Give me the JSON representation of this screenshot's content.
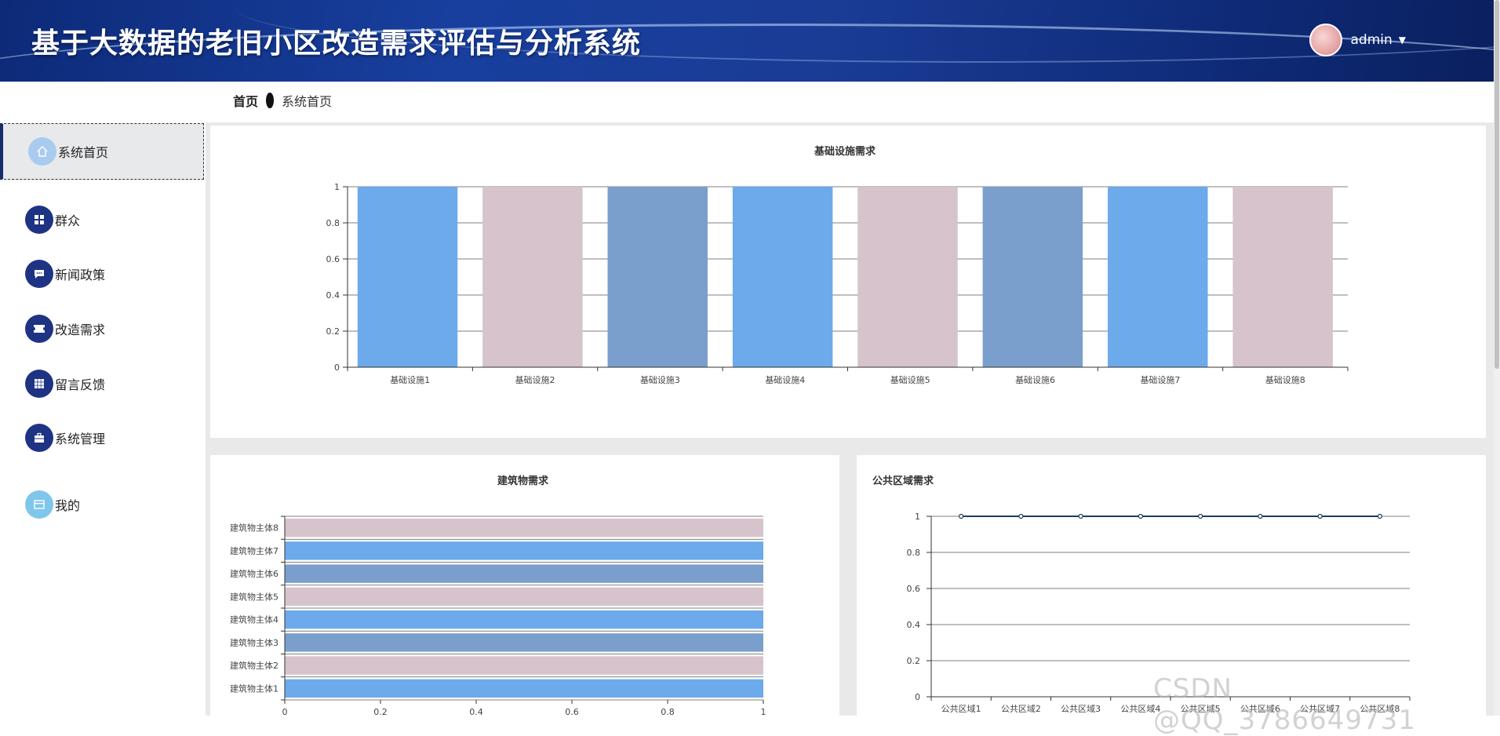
{
  "header": {
    "title": "基于大数据的老旧小区改造需求评估与分析系统",
    "username": "admin"
  },
  "breadcrumb": {
    "home": "首页",
    "current": "系统首页"
  },
  "sidebar": {
    "items": [
      {
        "label": "系统首页",
        "icon": "home-icon"
      },
      {
        "label": "群众",
        "icon": "grid-icon"
      },
      {
        "label": "新闻政策",
        "icon": "message-icon"
      },
      {
        "label": "改造需求",
        "icon": "ticket-icon"
      },
      {
        "label": "留言反馈",
        "icon": "apps-icon"
      },
      {
        "label": "系统管理",
        "icon": "briefcase-icon"
      },
      {
        "label": "我的",
        "icon": "card-icon"
      }
    ]
  },
  "colors": {
    "blue": "#6caaeb",
    "pink": "#d6c3cb",
    "steel": "#7a9fcc",
    "line": "#1f3b5a"
  },
  "watermark": "CSDN @QQ_3786649731",
  "chart_data": [
    {
      "type": "bar",
      "title": "基础设施需求",
      "categories": [
        "基础设施1",
        "基础设施2",
        "基础设施3",
        "基础设施4",
        "基础设施5",
        "基础设施6",
        "基础设施7",
        "基础设施8"
      ],
      "values": [
        1,
        1,
        1,
        1,
        1,
        1,
        1,
        1
      ],
      "ylim": [
        0,
        1
      ],
      "yticks": [
        "0",
        "0.2",
        "0.4",
        "0.6",
        "0.8",
        "1"
      ],
      "grid": true
    },
    {
      "type": "bar",
      "orientation": "horizontal",
      "title": "建筑物需求",
      "categories": [
        "建筑物主体1",
        "建筑物主体2",
        "建筑物主体3",
        "建筑物主体4",
        "建筑物主体5",
        "建筑物主体6",
        "建筑物主体7",
        "建筑物主体8"
      ],
      "values": [
        1,
        1,
        1,
        1,
        1,
        1,
        1,
        1
      ],
      "xlim": [
        0,
        1
      ],
      "xticks": [
        "0",
        "0.2",
        "0.4",
        "0.6",
        "0.8",
        "1"
      ],
      "grid": true
    },
    {
      "type": "line",
      "title": "公共区域需求",
      "categories": [
        "公共区域1",
        "公共区域2",
        "公共区域3",
        "公共区域4",
        "公共区域5",
        "公共区域6",
        "公共区域7",
        "公共区域8"
      ],
      "values": [
        1,
        1,
        1,
        1,
        1,
        1,
        1,
        1
      ],
      "ylim": [
        0,
        1
      ],
      "yticks": [
        "0",
        "0.2",
        "0.4",
        "0.6",
        "0.8",
        "1"
      ],
      "grid": true
    }
  ]
}
